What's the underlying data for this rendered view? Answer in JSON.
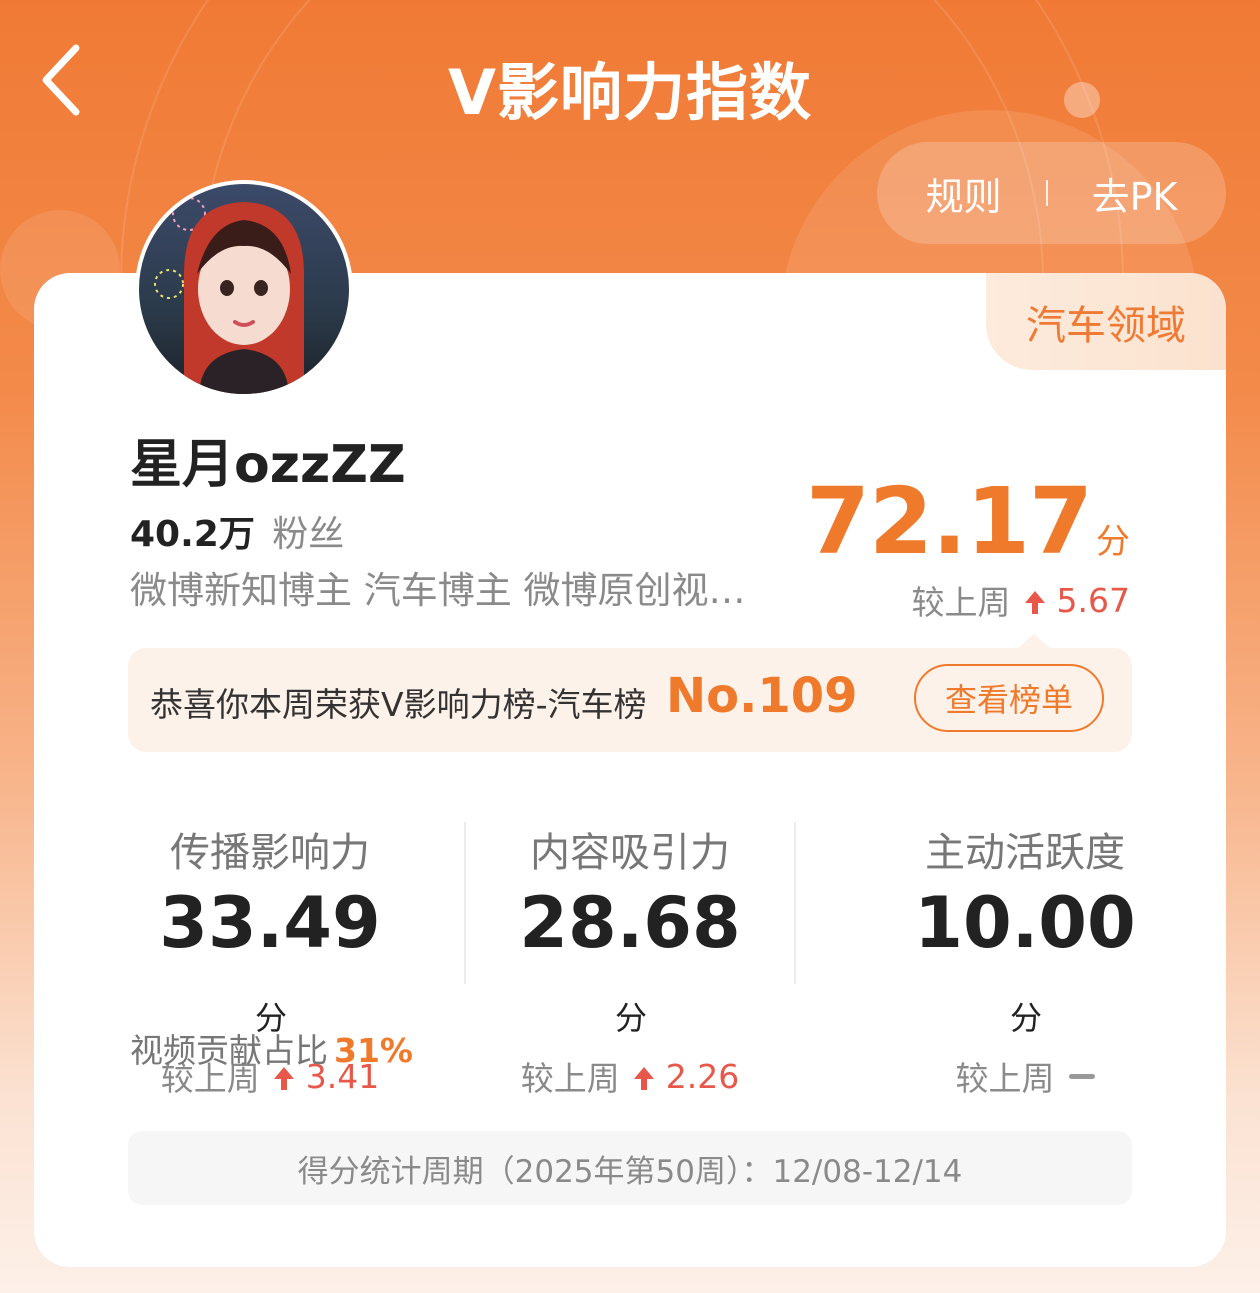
{
  "header": {
    "title": "V影响力指数"
  },
  "top_actions": {
    "rules_label": "规则",
    "separator": "I",
    "pk_label": "去PK"
  },
  "profile": {
    "domain_tag": "汽车领域",
    "username": "星月ozzZZ",
    "fans_count": "40.2万",
    "fans_label": "粉丝",
    "tags": "微博新知博主 汽车博主 微博原创视…"
  },
  "score": {
    "value": "72.17",
    "unit": "分",
    "change_label": "较上周",
    "change_value": "5.67"
  },
  "rank": {
    "text": "恭喜你本周荣获V影响力榜-汽车榜",
    "number": "No.109",
    "button_label": "查看榜单"
  },
  "metrics": [
    {
      "label": "传播影响力",
      "value": "33.49",
      "unit": "分",
      "change_label": "较上周",
      "change_value": "3.41",
      "trend": "up"
    },
    {
      "label": "内容吸引力",
      "value": "28.68",
      "unit": "分",
      "change_label": "较上周",
      "change_value": "2.26",
      "trend": "up"
    },
    {
      "label": "主动活跃度",
      "value": "10.00",
      "unit": "分",
      "change_label": "较上周",
      "trend": "flat"
    }
  ],
  "video_share": {
    "label": "视频贡献占比",
    "value": "31%"
  },
  "period": {
    "text": "得分统计周期（2025年第50周）：12/08-12/14"
  },
  "colors": {
    "accent": "#f07a2b",
    "up": "#e8584a",
    "header_bg": "#f07a35"
  }
}
